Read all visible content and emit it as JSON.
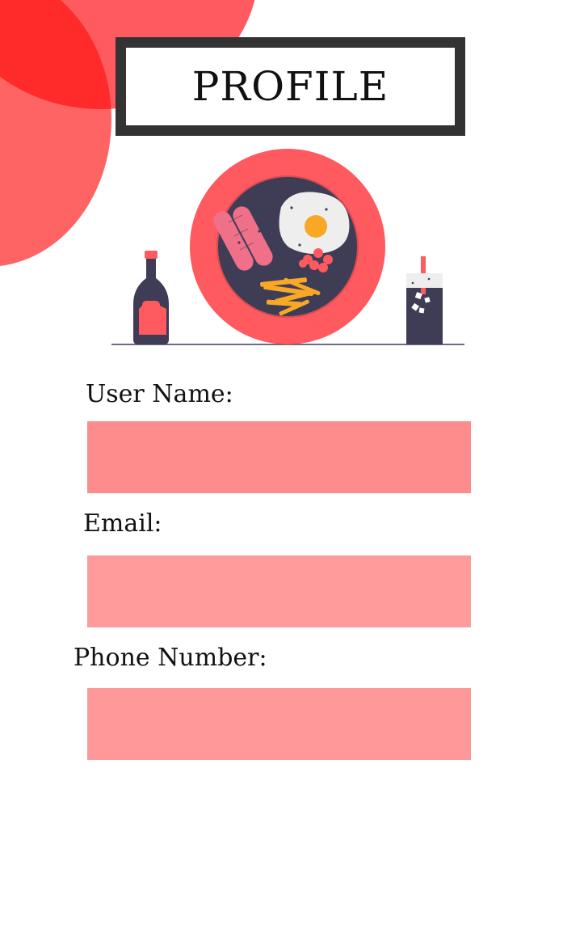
{
  "header": {
    "title": "PROFILE"
  },
  "illustration": {
    "icon": "breakfast-plate-illustration"
  },
  "form": {
    "user_name": {
      "label": "User Name:",
      "value": ""
    },
    "email": {
      "label": "Email:",
      "value": ""
    },
    "phone": {
      "label": "Phone Number:",
      "value": ""
    }
  },
  "colors": {
    "accent": "#ff6464",
    "title_border": "#333333",
    "field_user": "#ff8c8c",
    "field_email": "#ff9b9b",
    "field_phone": "#ff9999"
  }
}
